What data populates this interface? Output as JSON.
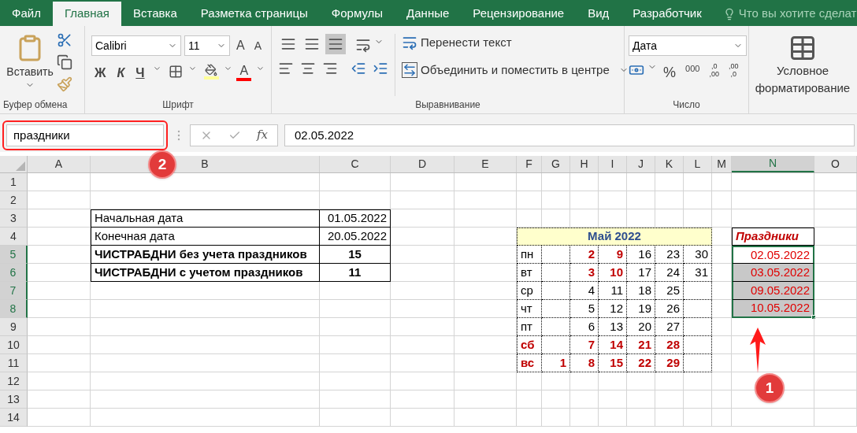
{
  "tabs": [
    {
      "label": "Файл",
      "selected": false
    },
    {
      "label": "Главная",
      "selected": true
    },
    {
      "label": "Вставка",
      "selected": false
    },
    {
      "label": "Разметка страницы",
      "selected": false
    },
    {
      "label": "Формулы",
      "selected": false
    },
    {
      "label": "Данные",
      "selected": false
    },
    {
      "label": "Рецензирование",
      "selected": false
    },
    {
      "label": "Вид",
      "selected": false
    },
    {
      "label": "Разработчик",
      "selected": false
    }
  ],
  "tell_me": {
    "placeholder": "Что вы хотите сделат"
  },
  "ribbon": {
    "clipboard": {
      "paste_label": "Вставить",
      "group_label": "Буфер обмена"
    },
    "font": {
      "font_name": "Calibri",
      "font_size": "11",
      "grow": "A",
      "shrink": "A",
      "bold": "Ж",
      "italic": "К",
      "underline": "Ч",
      "font_color": "A",
      "group_label": "Шрифт"
    },
    "alignment": {
      "vertical_align": [
        {
          "selected": false
        },
        {
          "selected": false
        },
        {
          "selected": true
        }
      ],
      "wrap_text": "Перенести текст",
      "merge": "Объединить и поместить в центре",
      "group_label": "Выравнивание"
    },
    "number": {
      "format": "Дата",
      "percent": "%",
      "thousands": "000",
      "increase_decimal": [
        ",0",
        ",00"
      ],
      "decrease_decimal": [
        ",00",
        ",0"
      ],
      "group_label": "Число"
    },
    "styles": {
      "conditional_formatting": "Условное форматирование"
    }
  },
  "formula_bar": {
    "name_box": "праздники",
    "fx": "fx",
    "value": "02.05.2022"
  },
  "sheet": {
    "columns": [
      {
        "label": "A",
        "selected": false
      },
      {
        "label": "B",
        "selected": false
      },
      {
        "label": "C",
        "selected": false
      },
      {
        "label": "D",
        "selected": false
      },
      {
        "label": "E",
        "selected": false
      },
      {
        "label": "F",
        "selected": false
      },
      {
        "label": "G",
        "selected": false
      },
      {
        "label": "H",
        "selected": false
      },
      {
        "label": "I",
        "selected": false
      },
      {
        "label": "J",
        "selected": false
      },
      {
        "label": "K",
        "selected": false
      },
      {
        "label": "L",
        "selected": false
      },
      {
        "label": "M",
        "selected": false
      },
      {
        "label": "N",
        "selected": true
      },
      {
        "label": "O",
        "selected": false
      }
    ],
    "rows": [
      {
        "label": "1",
        "selected": false
      },
      {
        "label": "2",
        "selected": false
      },
      {
        "label": "3",
        "selected": false
      },
      {
        "label": "4",
        "selected": false
      },
      {
        "label": "5",
        "selected": true
      },
      {
        "label": "6",
        "selected": true
      },
      {
        "label": "7",
        "selected": true
      },
      {
        "label": "8",
        "selected": true
      },
      {
        "label": "9",
        "selected": false
      },
      {
        "label": "10",
        "selected": false
      },
      {
        "label": "11",
        "selected": false
      },
      {
        "label": "12",
        "selected": false
      },
      {
        "label": "13",
        "selected": false
      },
      {
        "label": "14",
        "selected": false
      }
    ],
    "summary": [
      {
        "label": "Начальная дата",
        "value": "01.05.2022",
        "bold": false
      },
      {
        "label": "Конечная дата",
        "value": "20.05.2022",
        "bold": false
      },
      {
        "label": "ЧИСТРАБДНИ без учета праздников",
        "value": "15",
        "bold": true
      },
      {
        "label": "ЧИСТРАБДНИ с учетом праздников",
        "value": "11",
        "bold": true
      }
    ],
    "calendar": {
      "title": "Май 2022",
      "weeks": [
        {
          "weekday": "пн",
          "red": false,
          "first_week": false,
          "days": [
            {
              "text": "2",
              "red": true
            },
            {
              "text": "9",
              "red": true
            },
            {
              "text": "16",
              "red": false
            },
            {
              "text": "23",
              "red": false
            },
            {
              "text": "30",
              "red": false
            }
          ]
        },
        {
          "weekday": "вт",
          "red": false,
          "first_week": false,
          "days": [
            {
              "text": "3",
              "red": true
            },
            {
              "text": "10",
              "red": true
            },
            {
              "text": "17",
              "red": false
            },
            {
              "text": "24",
              "red": false
            },
            {
              "text": "31",
              "red": false
            }
          ]
        },
        {
          "weekday": "ср",
          "red": false,
          "first_week": false,
          "days": [
            {
              "text": "4",
              "red": false
            },
            {
              "text": "11",
              "red": false
            },
            {
              "text": "18",
              "red": false
            },
            {
              "text": "25",
              "red": false
            }
          ]
        },
        {
          "weekday": "чт",
          "red": false,
          "first_week": false,
          "days": [
            {
              "text": "5",
              "red": false
            },
            {
              "text": "12",
              "red": false
            },
            {
              "text": "19",
              "red": false
            },
            {
              "text": "26",
              "red": false
            }
          ]
        },
        {
          "weekday": "пт",
          "red": false,
          "first_week": false,
          "days": [
            {
              "text": "6",
              "red": false
            },
            {
              "text": "13",
              "red": false
            },
            {
              "text": "20",
              "red": false
            },
            {
              "text": "27",
              "red": false
            }
          ]
        },
        {
          "weekday": "сб",
          "red": true,
          "first_week": false,
          "days": [
            {
              "text": "7",
              "red": true
            },
            {
              "text": "14",
              "red": true
            },
            {
              "text": "21",
              "red": true
            },
            {
              "text": "28",
              "red": true
            }
          ]
        },
        {
          "weekday": "вс",
          "red": true,
          "first_week": true,
          "days": [
            {
              "text": "1",
              "red": true
            },
            {
              "text": "8",
              "red": true
            },
            {
              "text": "15",
              "red": true
            },
            {
              "text": "22",
              "red": true
            },
            {
              "text": "29",
              "red": true
            }
          ]
        }
      ]
    },
    "holidays": {
      "header": "Праздники",
      "items": [
        {
          "text": "02.05.2022",
          "shaded": false
        },
        {
          "text": "03.05.2022",
          "shaded": true
        },
        {
          "text": "09.05.2022",
          "shaded": true
        },
        {
          "text": "10.05.2022",
          "shaded": true
        }
      ]
    }
  },
  "annotations": [
    {
      "label": "2"
    },
    {
      "label": "1"
    }
  ]
}
